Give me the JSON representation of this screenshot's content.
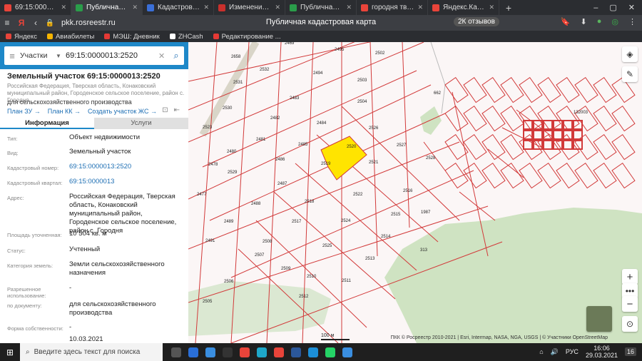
{
  "browser": {
    "tabs": [
      {
        "label": "69:15:0000013:2520 —",
        "color": "#e9443a",
        "active": false
      },
      {
        "label": "Публичная кадастро",
        "color": "#2a9d4a",
        "active": true
      },
      {
        "label": "Кадастровый квартал",
        "color": "#3a6fd8",
        "active": false
      },
      {
        "label": "Изменение данных в",
        "color": "#c9302c",
        "active": false
      },
      {
        "label": "Публичная кадастро",
        "color": "#2a9d4a",
        "active": false
      },
      {
        "label": "городня тверская обл",
        "color": "#e9443a",
        "active": false
      },
      {
        "label": "Яндекс.Карты",
        "color": "#e9443a",
        "active": false
      }
    ],
    "url": "pkk.rosreestr.ru",
    "page_title": "Публичная кадастровая карта",
    "reviews": "2К отзывов",
    "bookmarks": [
      "Яндекс",
      "Авиабилеты",
      "МЭШ: Дневник",
      "ZHCash",
      "Редактирование ..."
    ]
  },
  "search": {
    "category": "Участки",
    "value": "69:15:0000013:2520"
  },
  "parcel": {
    "title": "Земельный участок 69:15:0000013:2520",
    "description": "Российская Федерация, Тверская область, Конаковский муниципальный район, Городенское сельское поселение, район с. Городня",
    "purpose": "для сельскохозяйственного производства",
    "links": [
      "План ЗУ →",
      "План КК →",
      "Создать участок ЖС →"
    ],
    "tabs": [
      "Информация",
      "Услуги"
    ],
    "fields": [
      {
        "key": "Тип:",
        "value": "Объект недвижимости",
        "link": false
      },
      {
        "key": "Вид:",
        "value": "Земельный участок",
        "link": false
      },
      {
        "key": "Кадастровый номер:",
        "value": "69:15:0000013:2520",
        "link": true
      },
      {
        "key": "Кадастровый квартал:",
        "value": "69:15:0000013",
        "link": true
      },
      {
        "key": "Адрес:",
        "value": "Российская Федерация, Тверская область, Конаковский муниципальный район, Городенское сельское поселение, район с. Городня",
        "link": false
      },
      {
        "key": "Площадь уточненная:",
        "value": "10 504 кв. м",
        "link": false
      },
      {
        "key": "Статус:",
        "value": "Учтенный",
        "link": false
      },
      {
        "key": "Категория земель:",
        "value": "Земли сельскохозяйственного назначения",
        "link": false
      },
      {
        "key": "Разрешенное использование:",
        "value": "-",
        "link": false
      },
      {
        "key": "по документу:",
        "value": "для сельскохозяйственного производства",
        "link": false
      },
      {
        "key": "Форма собственности:",
        "value": "-",
        "link": false
      },
      {
        "key": "",
        "value": "10.03.2021",
        "link": false
      }
    ]
  },
  "map": {
    "parcel_labels": [
      "2469",
      "2658",
      "2495",
      "2502",
      "2532",
      "2494",
      "2503",
      "2531",
      "2483",
      "2504",
      "2530",
      "2482",
      "2484",
      "2526",
      "2523",
      "2481",
      "2485",
      "2520",
      "2527",
      "2480",
      "2486",
      "2519",
      "2521",
      "2528",
      "2478",
      "2529",
      "2487",
      "2522",
      "2516",
      "2477",
      "2488",
      "2518",
      "2515",
      "2489",
      "2517",
      "2524",
      "2491",
      "2508",
      "2525",
      "2514",
      "2507",
      "2513",
      "2509",
      "2506",
      "2510",
      "2511",
      "2505",
      "2512",
      "662",
      "313",
      "1987",
      "132003"
    ],
    "selected_label": "2520",
    "scale_label": "100 м",
    "attribution": "ПКК © Росреестр 2010-2021 | Esri, Intermap, NASA, NGA, USGS | © Участники OpenStreetMap"
  },
  "taskbar": {
    "search_placeholder": "Введите здесь текст для поиска",
    "time": "16:06",
    "date": "29.03.2021",
    "lang": "РУС",
    "notifications": "16"
  }
}
